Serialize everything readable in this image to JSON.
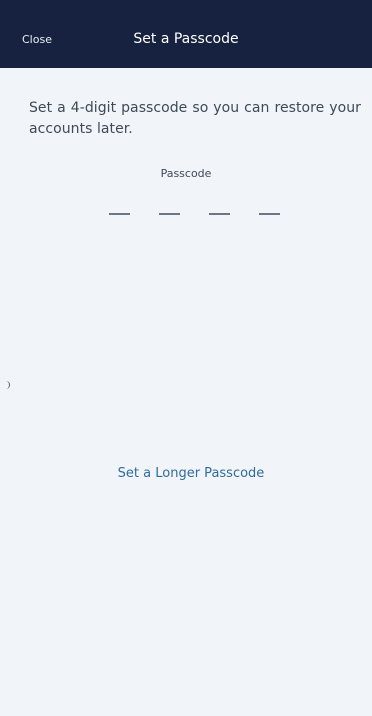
{
  "header": {
    "close_label": "Close",
    "title": "Set a Passcode"
  },
  "main": {
    "description": "Set a 4-digit passcode so you can restore your accounts later.",
    "passcode_label": "Passcode",
    "digit_count": 4,
    "entered_digits": 0,
    "longer_passcode_link": "Set a Longer Passcode"
  },
  "colors": {
    "header_background": "#16223f",
    "page_background": "#f1f4f9",
    "link": "#2f6c9a",
    "body_text": "#3e4a57"
  }
}
